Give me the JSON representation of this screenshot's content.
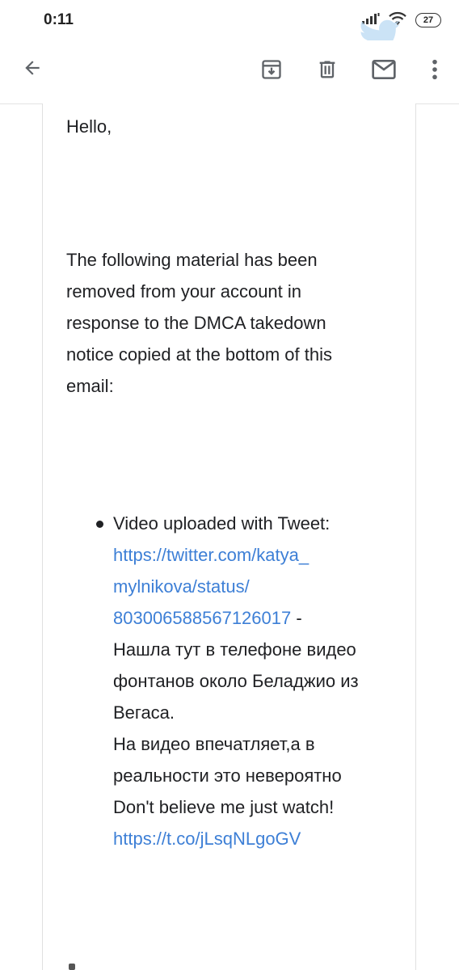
{
  "status_bar": {
    "time": "0:11",
    "battery_level": "27"
  },
  "toolbar": {
    "icons": [
      "back-arrow-icon",
      "archive-icon",
      "delete-icon",
      "mark-unread-icon",
      "more-vert-icon"
    ]
  },
  "email": {
    "greeting": "Hello,",
    "intro_lines": [
      "The following material has been",
      "removed from your account in",
      "response to the DMCA takedown",
      "notice copied at the bottom of this",
      "email:"
    ],
    "item": {
      "prefix": "Video uploaded with Tweet:",
      "link_lines": [
        "https://twitter.com/katya_",
        "mylnikova/status/",
        "803006588567126017"
      ],
      "separator": " -",
      "text_lines": [
        "Нашла тут в телефоне видео",
        "фонтанов около Беладжио из",
        "Вегаса.",
        "На видео впечатляет,а в",
        "реальности это невероятно",
        "Don't believe me just watch!"
      ],
      "short_link": "https://t.co/jLsqNLgoGV"
    }
  },
  "colors": {
    "link": "#3d7fd6",
    "text": "#202124",
    "icon": "#5f6368"
  }
}
